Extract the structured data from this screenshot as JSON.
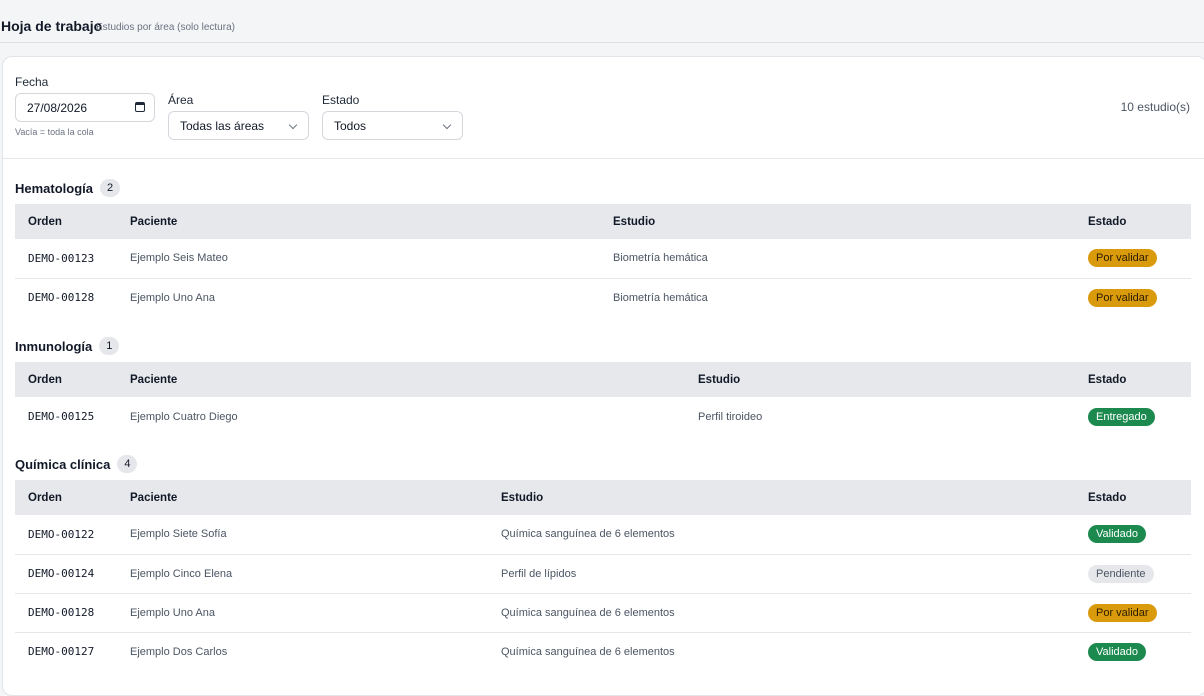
{
  "header": {
    "title": "Hoja de trabajo",
    "subtitle": "Estudios por área (solo lectura)"
  },
  "filters": {
    "fecha": {
      "label": "Fecha",
      "value": "27/08/2026",
      "hint": "Vacía = toda la cola",
      "icon": "calendar-icon"
    },
    "area": {
      "label": "Área",
      "value": "Todas las áreas",
      "icon": "chevron-down-icon"
    },
    "estado": {
      "label": "Estado",
      "value": "Todos",
      "icon": "chevron-down-icon"
    },
    "count": "10 estudio(s)"
  },
  "columns": {
    "orden": "Orden",
    "paciente": "Paciente",
    "estudio": "Estudio",
    "estado": "Estado"
  },
  "status_colors": {
    "Por validar": "#d99a0b",
    "Entregado": "#1c8a4f",
    "Validado": "#1c8a4f",
    "Pendiente": "#e5e7eb"
  },
  "sections": [
    {
      "name": "Hematología",
      "count": "2",
      "rows": [
        {
          "orden": "DEMO-00123",
          "paciente": "Ejemplo Seis Mateo",
          "estudio": "Biometría hemática",
          "estado": "Por validar"
        },
        {
          "orden": "DEMO-00128",
          "paciente": "Ejemplo Uno Ana",
          "estudio": "Biometría hemática",
          "estado": "Por validar"
        }
      ]
    },
    {
      "name": "Inmunología",
      "count": "1",
      "rows": [
        {
          "orden": "DEMO-00125",
          "paciente": "Ejemplo Cuatro Diego",
          "estudio": "Perfil tiroideo",
          "estado": "Entregado"
        }
      ]
    },
    {
      "name": "Química clínica",
      "count": "4",
      "rows": [
        {
          "orden": "DEMO-00122",
          "paciente": "Ejemplo Siete Sofía",
          "estudio": "Química sanguínea de 6 elementos",
          "estado": "Validado"
        },
        {
          "orden": "DEMO-00124",
          "paciente": "Ejemplo Cinco Elena",
          "estudio": "Perfil de lípidos",
          "estado": "Pendiente"
        },
        {
          "orden": "DEMO-00128",
          "paciente": "Ejemplo Uno Ana",
          "estudio": "Química sanguínea de 6 elementos",
          "estado": "Por validar"
        },
        {
          "orden": "DEMO-00127",
          "paciente": "Ejemplo Dos Carlos",
          "estudio": "Química sanguínea de 6 elementos",
          "estado": "Validado"
        }
      ]
    }
  ]
}
